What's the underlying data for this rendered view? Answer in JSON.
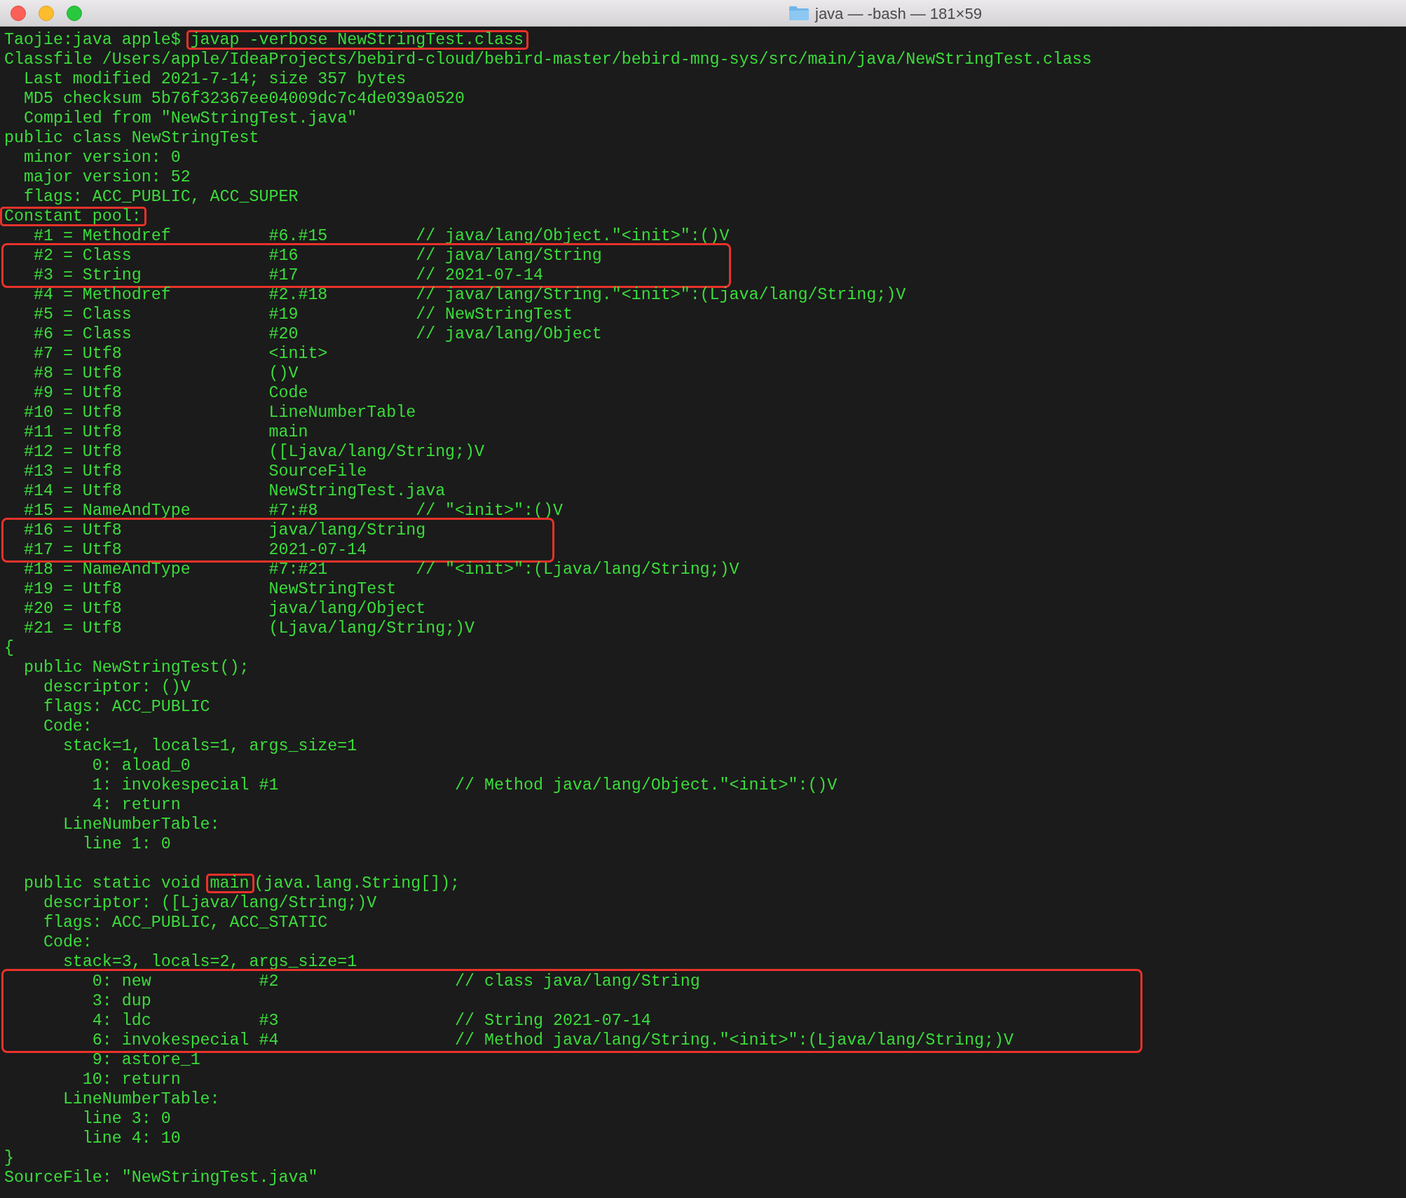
{
  "window": {
    "title": "java — -bash — 181×59"
  },
  "lines": [
    {
      "kind": "line",
      "parts": [
        {
          "text": "Taojie:java apple$ ",
          "boxed": false
        },
        {
          "text": "javap -verbose NewStringTest.class",
          "boxed": true
        }
      ]
    },
    {
      "kind": "line",
      "text": "Classfile /Users/apple/IdeaProjects/bebird-cloud/bebird-master/bebird-mng-sys/src/main/java/NewStringTest.class"
    },
    {
      "kind": "line",
      "text": "  Last modified 2021-7-14; size 357 bytes"
    },
    {
      "kind": "line",
      "text": "  MD5 checksum 5b76f32367ee04009dc7c4de039a0520"
    },
    {
      "kind": "line",
      "text": "  Compiled from \"NewStringTest.java\""
    },
    {
      "kind": "line",
      "text": "public class NewStringTest"
    },
    {
      "kind": "line",
      "text": "  minor version: 0"
    },
    {
      "kind": "line",
      "text": "  major version: 52"
    },
    {
      "kind": "line",
      "text": "  flags: ACC_PUBLIC, ACC_SUPER"
    },
    {
      "kind": "line",
      "parts": [
        {
          "text": "Constant pool:",
          "boxed": true
        }
      ]
    },
    {
      "kind": "line",
      "text": "   #1 = Methodref          #6.#15         // java/lang/Object.\"<init>\":()V"
    },
    {
      "kind": "box",
      "lines": [
        "   #2 = Class              #16            // java/lang/String",
        "   #3 = String             #17            // 2021-07-14"
      ]
    },
    {
      "kind": "line",
      "text": "   #4 = Methodref          #2.#18         // java/lang/String.\"<init>\":(Ljava/lang/String;)V"
    },
    {
      "kind": "line",
      "text": "   #5 = Class              #19            // NewStringTest"
    },
    {
      "kind": "line",
      "text": "   #6 = Class              #20            // java/lang/Object"
    },
    {
      "kind": "line",
      "text": "   #7 = Utf8               <init>"
    },
    {
      "kind": "line",
      "text": "   #8 = Utf8               ()V"
    },
    {
      "kind": "line",
      "text": "   #9 = Utf8               Code"
    },
    {
      "kind": "line",
      "text": "  #10 = Utf8               LineNumberTable"
    },
    {
      "kind": "line",
      "text": "  #11 = Utf8               main"
    },
    {
      "kind": "line",
      "text": "  #12 = Utf8               ([Ljava/lang/String;)V"
    },
    {
      "kind": "line",
      "text": "  #13 = Utf8               SourceFile"
    },
    {
      "kind": "line",
      "text": "  #14 = Utf8               NewStringTest.java"
    },
    {
      "kind": "line",
      "text": "  #15 = NameAndType        #7:#8          // \"<init>\":()V"
    },
    {
      "kind": "box",
      "lines": [
        "  #16 = Utf8               java/lang/String",
        "  #17 = Utf8               2021-07-14"
      ]
    },
    {
      "kind": "line",
      "text": "  #18 = NameAndType        #7:#21         // \"<init>\":(Ljava/lang/String;)V"
    },
    {
      "kind": "line",
      "text": "  #19 = Utf8               NewStringTest"
    },
    {
      "kind": "line",
      "text": "  #20 = Utf8               java/lang/Object"
    },
    {
      "kind": "line",
      "text": "  #21 = Utf8               (Ljava/lang/String;)V"
    },
    {
      "kind": "line",
      "text": "{"
    },
    {
      "kind": "line",
      "text": "  public NewStringTest();"
    },
    {
      "kind": "line",
      "text": "    descriptor: ()V"
    },
    {
      "kind": "line",
      "text": "    flags: ACC_PUBLIC"
    },
    {
      "kind": "line",
      "text": "    Code:"
    },
    {
      "kind": "line",
      "text": "      stack=1, locals=1, args_size=1"
    },
    {
      "kind": "line",
      "text": "         0: aload_0"
    },
    {
      "kind": "line",
      "text": "         1: invokespecial #1                  // Method java/lang/Object.\"<init>\":()V"
    },
    {
      "kind": "line",
      "text": "         4: return"
    },
    {
      "kind": "line",
      "text": "      LineNumberTable:"
    },
    {
      "kind": "line",
      "text": "        line 1: 0"
    },
    {
      "kind": "blank"
    },
    {
      "kind": "line",
      "parts": [
        {
          "text": "  public static void ",
          "boxed": false
        },
        {
          "text": "main",
          "boxed": true
        },
        {
          "text": "(java.lang.String[]);",
          "boxed": false
        }
      ]
    },
    {
      "kind": "line",
      "text": "    descriptor: ([Ljava/lang/String;)V"
    },
    {
      "kind": "line",
      "text": "    flags: ACC_PUBLIC, ACC_STATIC"
    },
    {
      "kind": "line",
      "text": "    Code:"
    },
    {
      "kind": "line",
      "text": "      stack=3, locals=2, args_size=1"
    },
    {
      "kind": "box",
      "lines": [
        "         0: new           #2                  // class java/lang/String",
        "         3: dup",
        "         4: ldc           #3                  // String 2021-07-14",
        "         6: invokespecial #4                  // Method java/lang/String.\"<init>\":(Ljava/lang/String;)V"
      ]
    },
    {
      "kind": "line",
      "text": "         9: astore_1"
    },
    {
      "kind": "line",
      "text": "        10: return"
    },
    {
      "kind": "line",
      "text": "      LineNumberTable:"
    },
    {
      "kind": "line",
      "text": "        line 3: 0"
    },
    {
      "kind": "line",
      "text": "        line 4: 10"
    },
    {
      "kind": "line",
      "text": "}"
    },
    {
      "kind": "line",
      "text": "SourceFile: \"NewStringTest.java\""
    }
  ]
}
